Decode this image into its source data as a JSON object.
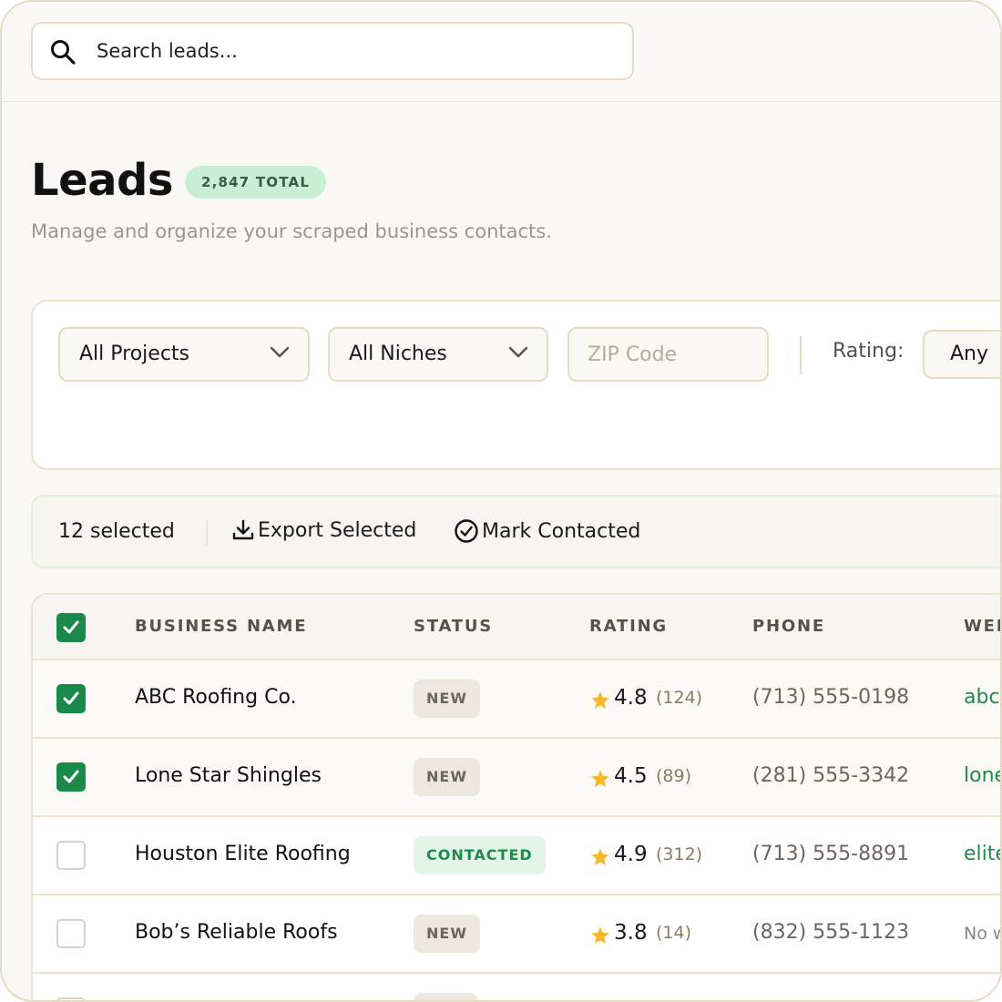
{
  "search": {
    "placeholder": "Search leads...",
    "icon": "search-icon"
  },
  "header": {
    "title": "Leads",
    "total_badge": "2,847 TOTAL",
    "subtitle": "Manage and organize your scraped business contacts."
  },
  "filters": {
    "project": "All Projects",
    "niche": "All Niches",
    "zip_placeholder": "ZIP Code",
    "rating_label": "Rating:",
    "rating_value": "Any"
  },
  "selection": {
    "count_label": "12 selected",
    "export_label": "Export Selected",
    "mark_contacted_label": "Mark Contacted"
  },
  "table": {
    "columns": [
      "BUSINESS NAME",
      "STATUS",
      "RATING",
      "PHONE",
      "WEB"
    ],
    "rows": [
      {
        "checked": true,
        "name": "ABC Roofing Co.",
        "status": "NEW",
        "rating": "4.8",
        "reviews": "(124)",
        "phone": "(713) 555-0198",
        "website": "abc",
        "has_website": true
      },
      {
        "checked": true,
        "name": "Lone Star Shingles",
        "status": "NEW",
        "rating": "4.5",
        "reviews": "(89)",
        "phone": "(281) 555-3342",
        "website": "lone",
        "has_website": true
      },
      {
        "checked": false,
        "name": "Houston Elite Roofing",
        "status": "CONTACTED",
        "rating": "4.9",
        "reviews": "(312)",
        "phone": "(713) 555-8891",
        "website": "elite",
        "has_website": true
      },
      {
        "checked": false,
        "name": "Bob’s Reliable Roofs",
        "status": "NEW",
        "rating": "3.8",
        "reviews": "(14)",
        "phone": "(832) 555-1123",
        "website": "No w",
        "has_website": false
      }
    ]
  },
  "colors": {
    "accent_green": "#1a8a4a",
    "star": "#f5b82e",
    "border": "#e5dcc3",
    "background": "#faf8f5"
  }
}
